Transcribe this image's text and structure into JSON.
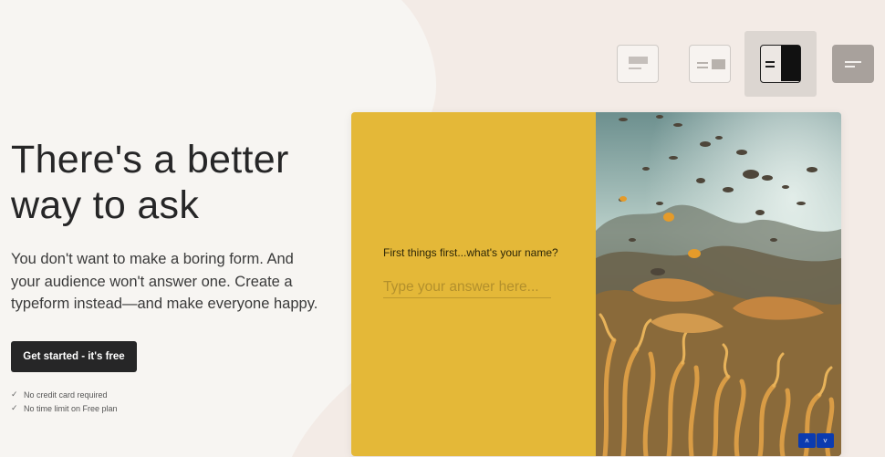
{
  "hero": {
    "headline_line1": "There's a better",
    "headline_line2": "way to ask",
    "subtext_line1": "You don't want to make a boring form. And",
    "subtext_line2": "your audience won't answer one. Create a",
    "subtext_line3": "typeform instead—and make everyone happy.",
    "cta_label": "Get started - it's free",
    "perks": [
      "No credit card required",
      "No time limit on Free plan"
    ]
  },
  "layout_switch": {
    "options": [
      "layout-stack-icon",
      "layout-split-small-icon",
      "layout-split-half-icon",
      "layout-wallpaper-icon"
    ],
    "selected": "layout-split-half-icon"
  },
  "demo_form": {
    "question": "First things first...what's your name?",
    "answer_placeholder": "Type your answer here...",
    "nav_up": "˄",
    "nav_down": "˅"
  },
  "colors": {
    "page_bg": "#f3ebe6",
    "left_panel_bg": "#f7f5f2",
    "cta_bg": "#262627",
    "form_yellow": "#e4b838",
    "nav_blue": "#0b3bb0",
    "selected_tile": "#dcd6d1",
    "wallpaper_tile": "#a8a19c"
  }
}
